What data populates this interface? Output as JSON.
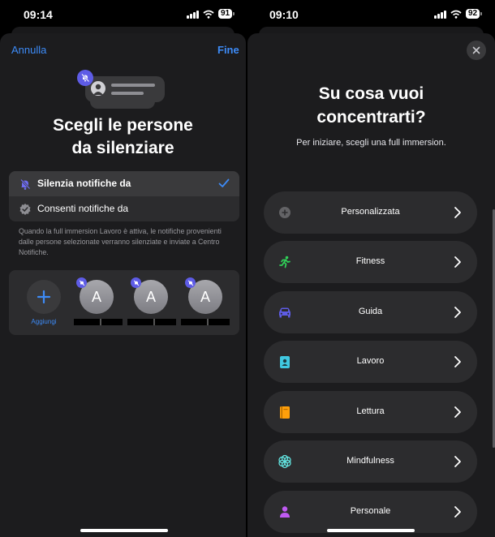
{
  "left": {
    "status": {
      "time": "09:14",
      "battery": "91"
    },
    "cancel_label": "Annulla",
    "done_label": "Fine",
    "title_line1": "Scegli le persone",
    "title_line2": "da silenziare",
    "options": [
      {
        "label": "Silenzia notifiche da",
        "selected": true,
        "icon": "bell-slash-icon"
      },
      {
        "label": "Consenti notifiche da",
        "selected": false,
        "icon": "checkmark-seal-icon"
      }
    ],
    "caption": "Quando la full immersion Lavoro è attiva, le notifiche provenienti dalle persone selezionate verranno silenziate e inviate a Centro Notifiche.",
    "add_label": "Aggiungi",
    "people": [
      {
        "initial": "A"
      },
      {
        "initial": "A"
      },
      {
        "initial": "A"
      }
    ]
  },
  "right": {
    "status": {
      "time": "09:10",
      "battery": "92"
    },
    "title_line1": "Su cosa vuoi",
    "title_line2": "concentrarti?",
    "subtitle": "Per iniziare, scegli una full immersion.",
    "items": [
      {
        "label": "Personalizzata",
        "icon": "plus-circle-icon",
        "color": "#636366"
      },
      {
        "label": "Fitness",
        "icon": "running-figure-icon",
        "color": "#30d158"
      },
      {
        "label": "Guida",
        "icon": "car-icon",
        "color": "#5e5ce6"
      },
      {
        "label": "Lavoro",
        "icon": "id-badge-icon",
        "color": "#40c8e0"
      },
      {
        "label": "Lettura",
        "icon": "book-icon",
        "color": "#ff9f0a"
      },
      {
        "label": "Mindfulness",
        "icon": "flower-icon",
        "color": "#63e6e2"
      },
      {
        "label": "Personale",
        "icon": "person-icon",
        "color": "#bf5af2"
      }
    ]
  },
  "colors": {
    "accent": "#3d8bf7",
    "focus_purple": "#5e5ce6",
    "card": "#2c2c2e",
    "sheet": "#1c1c1e"
  }
}
